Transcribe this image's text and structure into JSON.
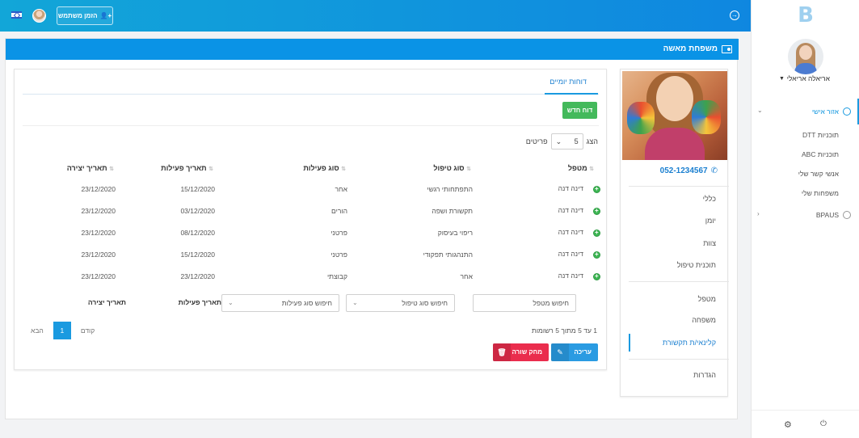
{
  "topbar": {
    "invite_label": "הזמן משתמש",
    "accent": "#0f87e0"
  },
  "sidebar": {
    "logo_letter": "B",
    "username": "אריאלה אריאלי",
    "items": [
      {
        "label": "אזור אישי",
        "active": true
      },
      {
        "label": "תוכניות DTT"
      },
      {
        "label": "תוכניות ABC"
      },
      {
        "label": "אנשי קשר שלי"
      },
      {
        "label": "משפחות שלי"
      },
      {
        "label": "BPAUS"
      }
    ]
  },
  "main": {
    "title": "משפחת מאשה"
  },
  "profile": {
    "phone": "052-1234567",
    "menu": [
      {
        "label": "כללי"
      },
      {
        "label": "יומן"
      },
      {
        "label": "צוות"
      },
      {
        "label": "תוכנית טיפול"
      },
      {
        "label": "מטפל"
      },
      {
        "label": "משפחה"
      },
      {
        "label": "קלינאי/ת תקשורת",
        "active": true
      },
      {
        "label": "הגדרות"
      }
    ]
  },
  "content": {
    "tab": "דוחות יומיים",
    "new_button": "דוח חדש",
    "show_label": "הצג",
    "page_size": "5",
    "items_label": "פריטים",
    "columns": [
      "מטפל",
      "סוג טיפול",
      "סוג פעילות",
      "תאריך פעילות",
      "תאריך יצירה"
    ],
    "rows": [
      [
        "דינה דנה",
        "התפתחותי רגשי",
        "אחר",
        "15/12/2020",
        "23/12/2020"
      ],
      [
        "דינה דנה",
        "תקשורת ושפה",
        "הורים",
        "03/12/2020",
        "23/12/2020"
      ],
      [
        "דינה דנה",
        "ריפוי בעיסוק",
        "פרטני",
        "08/12/2020",
        "23/12/2020"
      ],
      [
        "דינה דנה",
        "התנהגותי תפקודי",
        "פרטני",
        "15/12/2020",
        "23/12/2020"
      ],
      [
        "דינה דנה",
        "אחר",
        "קבוצתי",
        "23/12/2020",
        "23/12/2020"
      ]
    ],
    "filters": {
      "therapist_placeholder": "חיפוש מטפל",
      "treatment_placeholder": "חיפוש סוג טיפול",
      "activity_placeholder": "חיפוש סוג פעילות",
      "activity_date_label": "תאריך פעילות",
      "created_date_label": "תאריך יצירה"
    },
    "records_text": "1 עד 5 מתוך 5 רשומות",
    "pager": {
      "prev": "קודם",
      "page": "1",
      "next": "הבא"
    },
    "edit_button": "עריכה",
    "delete_button": "מחק שורה",
    "colors": {
      "new": "#43b95b",
      "edit": "#2a9be2",
      "delete": "#ea2d4d"
    }
  }
}
